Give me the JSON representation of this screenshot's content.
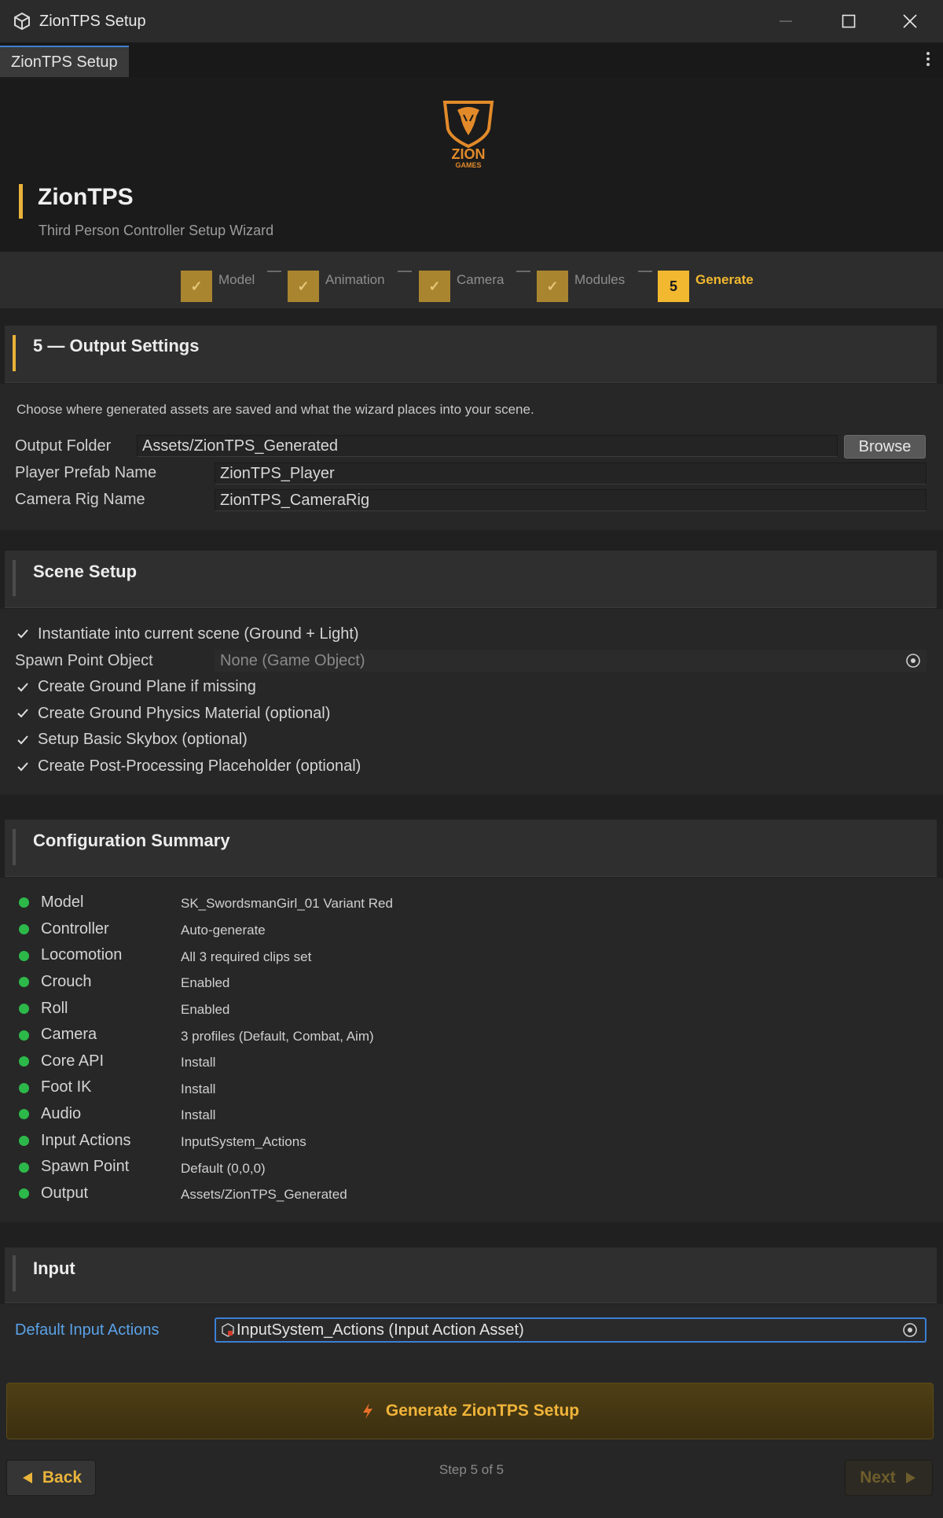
{
  "window": {
    "title": "ZionTPS Setup"
  },
  "tab": {
    "label": "ZionTPS Setup"
  },
  "header": {
    "logo_text_1": "ZION",
    "logo_text_2": "GAMES",
    "title": "ZionTPS",
    "subtitle": "Third Person Controller Setup Wizard"
  },
  "stepper": {
    "steps": [
      {
        "label": "Model",
        "state": "done"
      },
      {
        "label": "Animation",
        "state": "done"
      },
      {
        "label": "Camera",
        "state": "done"
      },
      {
        "label": "Modules",
        "state": "done"
      },
      {
        "number": "5",
        "label": "Generate",
        "state": "active"
      }
    ]
  },
  "output": {
    "title": "5 — Output Settings",
    "description": "Choose where generated assets are saved and what the wizard places into your scene.",
    "output_folder_label": "Output Folder",
    "output_folder_value": "Assets/ZionTPS_Generated",
    "browse_label": "Browse",
    "prefab_label": "Player Prefab Name",
    "prefab_value": "ZionTPS_Player",
    "rig_label": "Camera Rig Name",
    "rig_value": "ZionTPS_CameraRig"
  },
  "scene": {
    "title": "Scene Setup",
    "instantiate_label": "Instantiate into current scene (Ground + Light)",
    "spawn_label": "Spawn Point Object",
    "spawn_value": "None (Game Object)",
    "options": [
      "Create Ground Plane if missing",
      "Create Ground Physics Material (optional)",
      "Setup Basic Skybox (optional)",
      "Create Post-Processing Placeholder (optional)"
    ]
  },
  "summary": {
    "title": "Configuration Summary",
    "rows": [
      {
        "key": "Model",
        "value": "SK_SwordsmanGirl_01 Variant Red"
      },
      {
        "key": "Controller",
        "value": "Auto-generate"
      },
      {
        "key": "Locomotion",
        "value": "All 3 required clips set"
      },
      {
        "key": "Crouch",
        "value": "Enabled"
      },
      {
        "key": "Roll",
        "value": "Enabled"
      },
      {
        "key": "Camera",
        "value": "3 profiles (Default, Combat, Aim)"
      },
      {
        "key": "Core API",
        "value": "Install"
      },
      {
        "key": "Foot IK",
        "value": "Install"
      },
      {
        "key": "Audio",
        "value": "Install"
      },
      {
        "key": "Input Actions",
        "value": "InputSystem_Actions"
      },
      {
        "key": "Spawn Point",
        "value": "Default (0,0,0)"
      },
      {
        "key": "Output",
        "value": "Assets/ZionTPS_Generated"
      }
    ]
  },
  "input": {
    "title": "Input",
    "label": "Default Input Actions",
    "value": "InputSystem_Actions (Input Action Asset)"
  },
  "footer": {
    "generate_label": "Generate ZionTPS Setup",
    "back_label": "Back",
    "next_label": "Next",
    "step_text": "Step 5 of 5"
  },
  "colors": {
    "accent": "#f2b82f",
    "status_ok": "#2db84a",
    "link": "#5aa2e8"
  }
}
